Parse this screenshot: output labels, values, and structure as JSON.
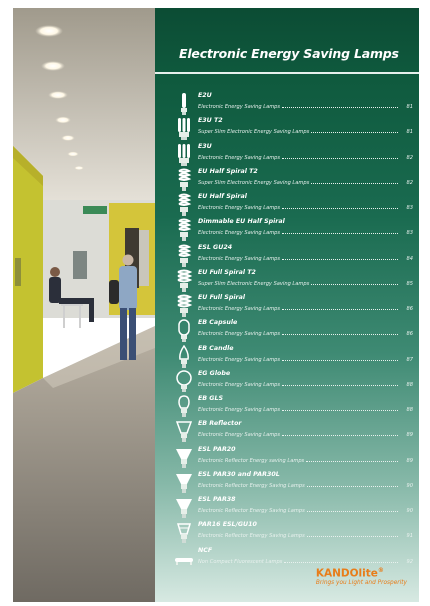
{
  "title": "Electronic Energy Saving Lamps",
  "items": [
    {
      "name": "E2U",
      "desc": "Electronic Energy Saving Lamps",
      "page": "81",
      "icon": "stick-lamp-icon"
    },
    {
      "name": "E3U T2",
      "desc": "Super Slim Electronic Energy Saving Lamps",
      "page": "81",
      "icon": "triple-u-lamp-icon"
    },
    {
      "name": "E3U",
      "desc": "Electronic Energy Saving Lamps",
      "page": "82",
      "icon": "triple-u-lamp-icon"
    },
    {
      "name": "EU Half Spiral T2",
      "desc": "Super Slim Electronic Energy Saving Lamps",
      "page": "82",
      "icon": "spiral-lamp-icon"
    },
    {
      "name": "EU Half Spiral",
      "desc": "Electronic Energy Saving Lamps",
      "page": "83",
      "icon": "spiral-lamp-icon"
    },
    {
      "name": "Dimmable EU Half Spiral",
      "desc": "Electronic Energy Saving Lamps",
      "page": "83",
      "icon": "spiral-lamp-icon"
    },
    {
      "name": "ESL GU24",
      "desc": "Electronic Energy Saving Lamps",
      "page": "84",
      "icon": "spiral-lamp-icon"
    },
    {
      "name": "EU Full Spiral T2",
      "desc": "Super Slim Electronic Energy Saving Lamps",
      "page": "85",
      "icon": "full-spiral-lamp-icon"
    },
    {
      "name": "EU Full Spiral",
      "desc": "Electronic Energy Saving Lamps",
      "page": "86",
      "icon": "full-spiral-lamp-icon"
    },
    {
      "name": "EB Capsule",
      "desc": "Electronic Energy Saving Lamps",
      "page": "86",
      "icon": "capsule-lamp-icon"
    },
    {
      "name": "EB Candle",
      "desc": "Electronic Energy Saving Lamps",
      "page": "87",
      "icon": "candle-lamp-icon"
    },
    {
      "name": "EG Globe",
      "desc": "Electronic Energy Saving Lamps",
      "page": "88",
      "icon": "globe-lamp-icon"
    },
    {
      "name": "EB GLS",
      "desc": "Electronic Energy Saving Lamps",
      "page": "88",
      "icon": "gls-lamp-icon"
    },
    {
      "name": "EB Reflector",
      "desc": "Electronic Energy Saving Lamps",
      "page": "89",
      "icon": "reflector-lamp-icon"
    },
    {
      "name": "ESL PAR20",
      "desc": "Electronic Reflector Energy saving Lamps",
      "page": "89",
      "icon": "par-lamp-icon"
    },
    {
      "name": "ESL PAR30 and PAR30L",
      "desc": "Electronic Reflector Energy Saving Lamps",
      "page": "90",
      "icon": "par-lamp-icon"
    },
    {
      "name": "ESL PAR38",
      "desc": "Electronic Reflector Energy Saving Lamps",
      "page": "90",
      "icon": "par-lamp-icon"
    },
    {
      "name": "PAR16 ESL/GU10",
      "desc": "Electronic Reflector Energy Saving Lamps",
      "page": "91",
      "icon": "par16-lamp-icon"
    },
    {
      "name": "NCF",
      "desc": "Non Compact Fluorescent Lamps",
      "page": "92",
      "icon": "ncf-lamp-icon"
    }
  ],
  "brand": {
    "name": "KANDOlite",
    "mark": "®",
    "tagline": "Brings you Light and Prosperity"
  }
}
